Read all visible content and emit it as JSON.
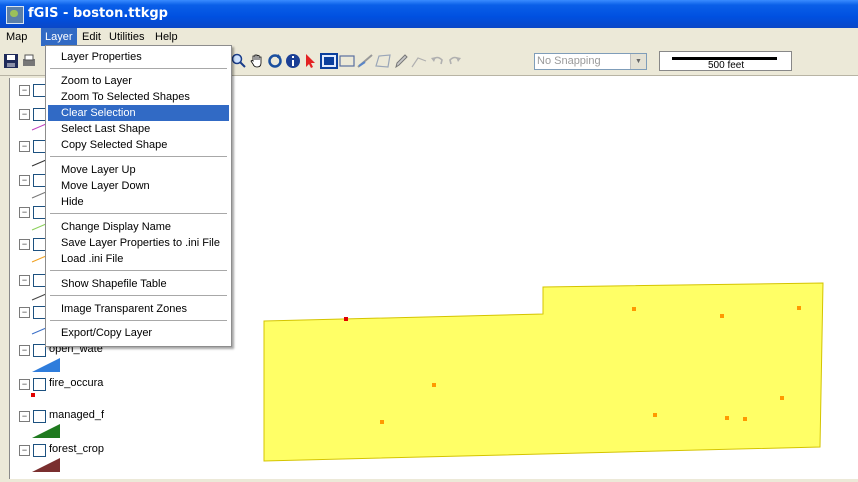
{
  "window": {
    "title": "fGIS - boston.ttkgp"
  },
  "menubar": {
    "items": [
      "Map",
      "Layer",
      "Edit",
      "Utilities",
      "Help"
    ]
  },
  "toolbar": {
    "snapping": "No Snapping",
    "scale_label": "500 feet"
  },
  "layer_menu": {
    "properties": "Layer Properties",
    "zoom_to_layer": "Zoom to Layer",
    "zoom_selected": "Zoom To Selected Shapes",
    "clear_selection": "Clear Selection",
    "select_last": "Select Last Shape",
    "copy_selected": "Copy Selected Shape",
    "move_up": "Move Layer Up",
    "move_down": "Move Layer Down",
    "hide": "Hide",
    "change_name": "Change Display Name",
    "save_ini": "Save Layer Properties to .ini File",
    "load_ini": "Load .ini File",
    "show_table": "Show Shapefile Table",
    "transparent": "Image Transparent Zones",
    "export": "Export/Copy Layer"
  },
  "legend": {
    "layers": [
      {
        "name": "open_wate",
        "checked": false
      },
      {
        "name": "fire_occura",
        "checked": false
      },
      {
        "name": "managed_f",
        "checked": false
      },
      {
        "name": "forest_crop",
        "checked": false
      }
    ]
  },
  "colors": {
    "polygon_fill": "#ffff66",
    "polygon_stroke": "#d4c400",
    "points": "#ff9900",
    "selection": "#316ac5"
  }
}
